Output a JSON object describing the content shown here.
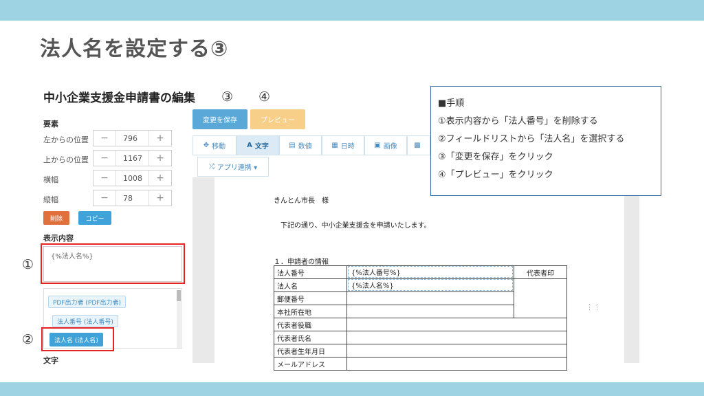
{
  "slide": {
    "title": "法人名を設定する③"
  },
  "editor": {
    "heading": "中小企業支援金申請書の編集",
    "element_label": "要素",
    "positions": [
      {
        "label": "左からの位置",
        "minus": "−",
        "value": "796",
        "plus": "+"
      },
      {
        "label": "上からの位置",
        "minus": "−",
        "value": "1167",
        "plus": "+"
      },
      {
        "label": "横幅",
        "minus": "−",
        "value": "1008",
        "plus": "+"
      },
      {
        "label": "縦幅",
        "minus": "−",
        "value": "78",
        "plus": "+"
      }
    ],
    "delete_label": "削除",
    "copy_label": "コピー",
    "display_label": "表示内容",
    "display_value": "{%法人名%}",
    "fields": [
      "PDF出力者 (PDF出力者)",
      "法人番号 (法人番号)",
      "法人名 (法人名)"
    ],
    "text_label": "文字"
  },
  "markers": {
    "m1": "①",
    "m2": "②",
    "m3": "③",
    "m4": "④"
  },
  "toolbar": {
    "save_label": "変更を保存",
    "preview_label": "プレビュー",
    "tabs": [
      {
        "icon": "✥",
        "label": "移動"
      },
      {
        "icon": "A",
        "label": "文字"
      },
      {
        "icon": "▤",
        "label": "数値"
      },
      {
        "icon": "▦",
        "label": "日時"
      },
      {
        "icon": "▣",
        "label": "画像"
      },
      {
        "icon": "▩",
        "label": ""
      }
    ],
    "app_link": {
      "icon": "⤮",
      "label": "アプリ連携 ▾"
    }
  },
  "document": {
    "addressee": "きんとん市長　様",
    "intro": "下記の通り、中小企業支援金を申請いたします。",
    "section": "１．申請者の情報",
    "rows": [
      "法人番号",
      "法人名",
      "郵便番号",
      "本社所在地",
      "代表者役職",
      "代表者氏名",
      "代表者生年月日",
      "メールアドレス"
    ],
    "seal_label": "代表者印",
    "field_number": "{%法人番号%}",
    "field_name": "{%法人名%}",
    "side_glyph": "⋮⋮"
  },
  "steps": {
    "header": "■手順",
    "items": [
      "①表示内容から「法人番号」を削除する",
      "②フィールドリストから「法人名」を選択する",
      "③「変更を保存」をクリック",
      "④「プレビュー」をクリック"
    ]
  }
}
